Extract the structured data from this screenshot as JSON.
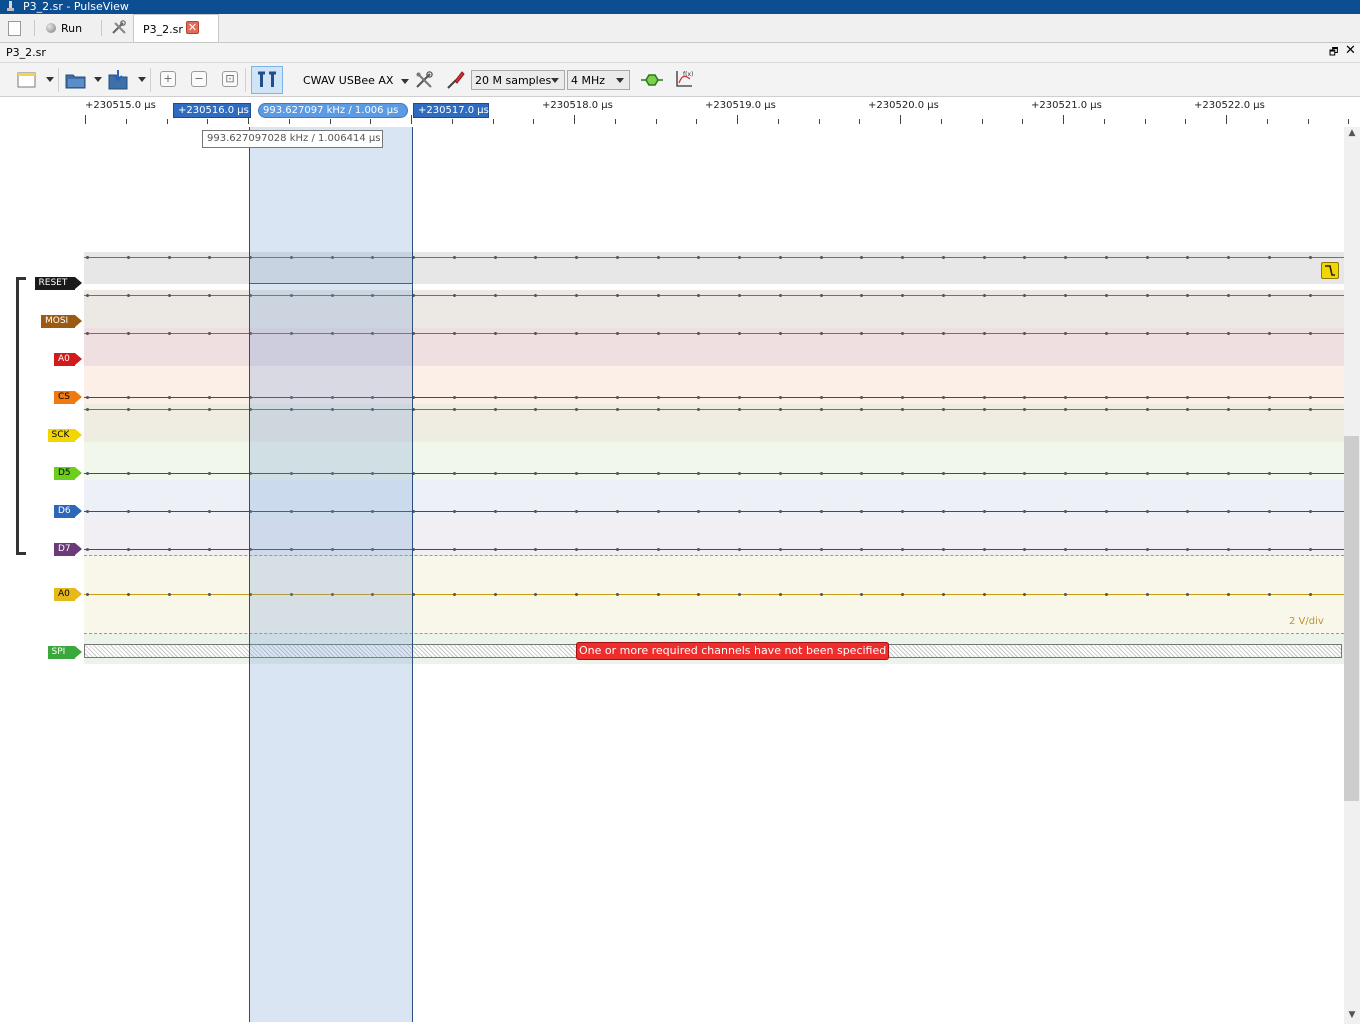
{
  "window": {
    "title": "P3_2.sr - PulseView"
  },
  "tabbar": {
    "run_label": "Run",
    "doc_tab_label": "P3_2.sr",
    "close_glyph": "✕"
  },
  "document": {
    "title": "P3_2.sr",
    "float_glyph": "🗗",
    "close_glyph": "✕"
  },
  "toolbar": {
    "device": "CWAV USBee AX",
    "samples": "20 M samples",
    "samplerate": "4 MHz",
    "zoom_in_glyph": "+",
    "zoom_out_glyph": "−",
    "zoom_fit_glyph": "⊡",
    "icons": [
      "new-session-icon",
      "open-file-icon",
      "save-file-icon",
      "zoom-in-icon",
      "zoom-out-icon",
      "zoom-fit-icon",
      "cursor-icon",
      "configure-device-icon",
      "probe-icon",
      "decoder-icon",
      "math-icon"
    ]
  },
  "ruler": {
    "labels": [
      "+230515.0 µs",
      "+230518.0 µs",
      "+230519.0 µs",
      "+230520.0 µs",
      "+230521.0 µs",
      "+230522.0 µs"
    ],
    "cursor_left": "+230516.0 µs",
    "cursor_mid": "993.627097 kHz / 1.006 µs",
    "cursor_right": "+230517.0 µs",
    "hidden_fragment": "6",
    "hidden_fragment_2": "+2305 17.0"
  },
  "tooltip": "993.627097028 kHz / 1.006414 µs",
  "channels": [
    {
      "label": "RESET",
      "color": "#1a1a1a",
      "text_color": "#ffffff"
    },
    {
      "label": "MOSI",
      "color": "#9a5a11",
      "text_color": "#ffffff"
    },
    {
      "label": "A0",
      "color": "#d11a1a",
      "text_color": "#ffffff"
    },
    {
      "label": "CS",
      "color": "#f07a10",
      "text_color": "#000000"
    },
    {
      "label": "SCK",
      "color": "#f2d600",
      "text_color": "#000000"
    },
    {
      "label": "D5",
      "color": "#6bcf1c",
      "text_color": "#000000"
    },
    {
      "label": "D6",
      "color": "#2f67b8",
      "text_color": "#ffffff"
    },
    {
      "label": "D7",
      "color": "#6a3b78",
      "text_color": "#ffffff"
    },
    {
      "label": "A0",
      "color": "#e5b81c",
      "text_color": "#000000"
    },
    {
      "label": "SPI",
      "color": "#3aa83a",
      "text_color": "#ffffff"
    }
  ],
  "analog": {
    "scale": "2 V/div"
  },
  "decoder": {
    "message": "One or more required channels have not been specified"
  }
}
